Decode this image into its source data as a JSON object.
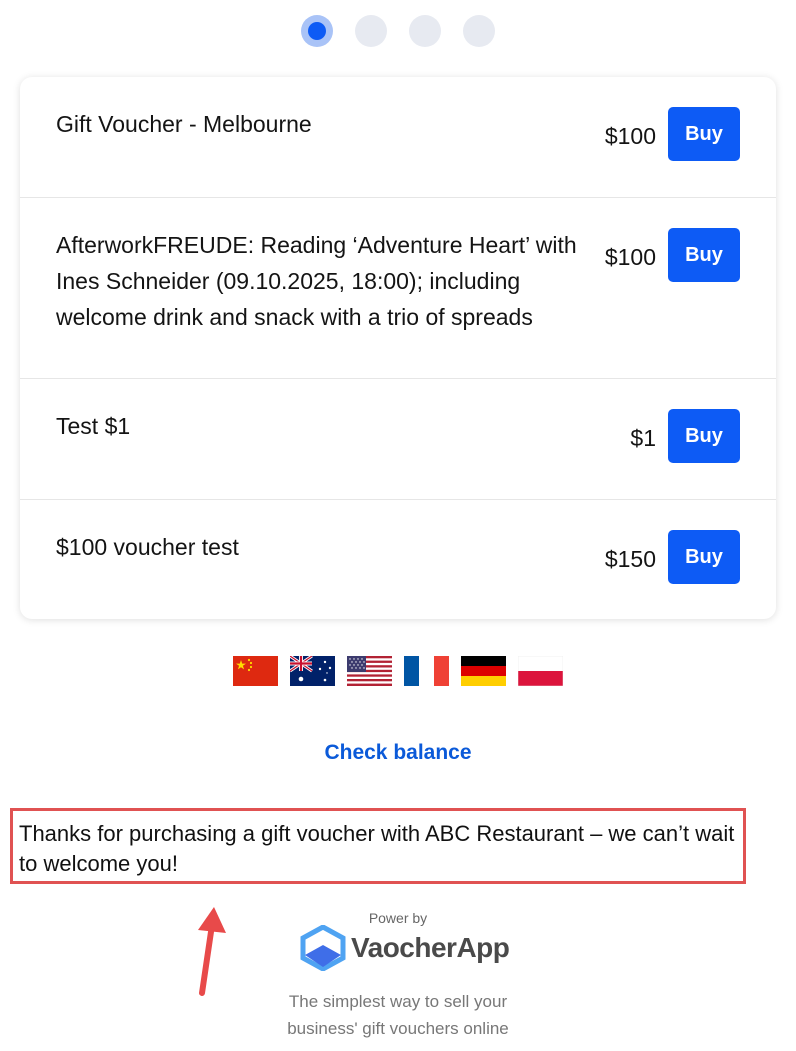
{
  "stepper": {
    "total_steps": 4,
    "current_step": 1
  },
  "vouchers": [
    {
      "title": "Gift Voucher - Melbourne",
      "price": "$100",
      "buy_label": "Buy"
    },
    {
      "title": "AfterworkFREUDE: Reading ‘Adventure Heart’ with Ines Schneider (09.10.2025, 18:00); including welcome drink and snack with a trio of spreads",
      "price": "$100",
      "buy_label": "Buy"
    },
    {
      "title": "Test $1",
      "price": "$1",
      "buy_label": "Buy"
    },
    {
      "title": "$100 voucher test",
      "price": "$150",
      "buy_label": "Buy"
    }
  ],
  "languages": [
    "china-flag-icon",
    "australia-flag-icon",
    "usa-flag-icon",
    "france-flag-icon",
    "germany-flag-icon",
    "poland-flag-icon"
  ],
  "check_balance_label": "Check balance",
  "thanks_message": "Thanks for purchasing a gift voucher with ABC Restaurant – we can’t wait to welcome you!",
  "footer": {
    "power_by": "Power by",
    "brand": "VaocherApp",
    "tagline_line1": "The simplest way to sell your",
    "tagline_line2": "business' gift vouchers online"
  },
  "colors": {
    "accent": "#0d5bf5",
    "link": "#0b5ad9",
    "annotation": "#e05252"
  }
}
